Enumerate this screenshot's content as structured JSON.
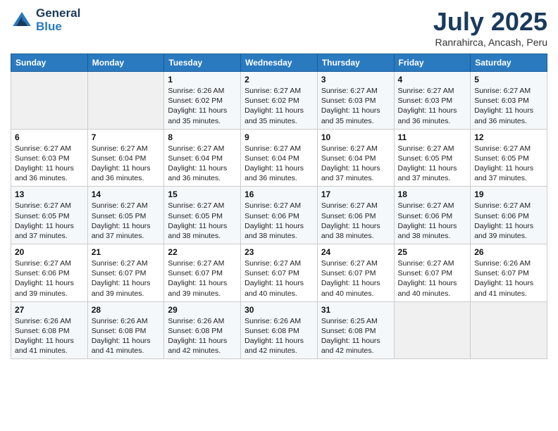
{
  "header": {
    "logo_general": "General",
    "logo_blue": "Blue",
    "title": "July 2025",
    "subtitle": "Ranrahirca, Ancash, Peru"
  },
  "weekdays": [
    "Sunday",
    "Monday",
    "Tuesday",
    "Wednesday",
    "Thursday",
    "Friday",
    "Saturday"
  ],
  "weeks": [
    [
      {
        "day": "",
        "info": ""
      },
      {
        "day": "",
        "info": ""
      },
      {
        "day": "1",
        "info": "Sunrise: 6:26 AM\nSunset: 6:02 PM\nDaylight: 11 hours and 35 minutes."
      },
      {
        "day": "2",
        "info": "Sunrise: 6:27 AM\nSunset: 6:02 PM\nDaylight: 11 hours and 35 minutes."
      },
      {
        "day": "3",
        "info": "Sunrise: 6:27 AM\nSunset: 6:03 PM\nDaylight: 11 hours and 35 minutes."
      },
      {
        "day": "4",
        "info": "Sunrise: 6:27 AM\nSunset: 6:03 PM\nDaylight: 11 hours and 36 minutes."
      },
      {
        "day": "5",
        "info": "Sunrise: 6:27 AM\nSunset: 6:03 PM\nDaylight: 11 hours and 36 minutes."
      }
    ],
    [
      {
        "day": "6",
        "info": "Sunrise: 6:27 AM\nSunset: 6:03 PM\nDaylight: 11 hours and 36 minutes."
      },
      {
        "day": "7",
        "info": "Sunrise: 6:27 AM\nSunset: 6:04 PM\nDaylight: 11 hours and 36 minutes."
      },
      {
        "day": "8",
        "info": "Sunrise: 6:27 AM\nSunset: 6:04 PM\nDaylight: 11 hours and 36 minutes."
      },
      {
        "day": "9",
        "info": "Sunrise: 6:27 AM\nSunset: 6:04 PM\nDaylight: 11 hours and 36 minutes."
      },
      {
        "day": "10",
        "info": "Sunrise: 6:27 AM\nSunset: 6:04 PM\nDaylight: 11 hours and 37 minutes."
      },
      {
        "day": "11",
        "info": "Sunrise: 6:27 AM\nSunset: 6:05 PM\nDaylight: 11 hours and 37 minutes."
      },
      {
        "day": "12",
        "info": "Sunrise: 6:27 AM\nSunset: 6:05 PM\nDaylight: 11 hours and 37 minutes."
      }
    ],
    [
      {
        "day": "13",
        "info": "Sunrise: 6:27 AM\nSunset: 6:05 PM\nDaylight: 11 hours and 37 minutes."
      },
      {
        "day": "14",
        "info": "Sunrise: 6:27 AM\nSunset: 6:05 PM\nDaylight: 11 hours and 37 minutes."
      },
      {
        "day": "15",
        "info": "Sunrise: 6:27 AM\nSunset: 6:05 PM\nDaylight: 11 hours and 38 minutes."
      },
      {
        "day": "16",
        "info": "Sunrise: 6:27 AM\nSunset: 6:06 PM\nDaylight: 11 hours and 38 minutes."
      },
      {
        "day": "17",
        "info": "Sunrise: 6:27 AM\nSunset: 6:06 PM\nDaylight: 11 hours and 38 minutes."
      },
      {
        "day": "18",
        "info": "Sunrise: 6:27 AM\nSunset: 6:06 PM\nDaylight: 11 hours and 38 minutes."
      },
      {
        "day": "19",
        "info": "Sunrise: 6:27 AM\nSunset: 6:06 PM\nDaylight: 11 hours and 39 minutes."
      }
    ],
    [
      {
        "day": "20",
        "info": "Sunrise: 6:27 AM\nSunset: 6:06 PM\nDaylight: 11 hours and 39 minutes."
      },
      {
        "day": "21",
        "info": "Sunrise: 6:27 AM\nSunset: 6:07 PM\nDaylight: 11 hours and 39 minutes."
      },
      {
        "day": "22",
        "info": "Sunrise: 6:27 AM\nSunset: 6:07 PM\nDaylight: 11 hours and 39 minutes."
      },
      {
        "day": "23",
        "info": "Sunrise: 6:27 AM\nSunset: 6:07 PM\nDaylight: 11 hours and 40 minutes."
      },
      {
        "day": "24",
        "info": "Sunrise: 6:27 AM\nSunset: 6:07 PM\nDaylight: 11 hours and 40 minutes."
      },
      {
        "day": "25",
        "info": "Sunrise: 6:27 AM\nSunset: 6:07 PM\nDaylight: 11 hours and 40 minutes."
      },
      {
        "day": "26",
        "info": "Sunrise: 6:26 AM\nSunset: 6:07 PM\nDaylight: 11 hours and 41 minutes."
      }
    ],
    [
      {
        "day": "27",
        "info": "Sunrise: 6:26 AM\nSunset: 6:08 PM\nDaylight: 11 hours and 41 minutes."
      },
      {
        "day": "28",
        "info": "Sunrise: 6:26 AM\nSunset: 6:08 PM\nDaylight: 11 hours and 41 minutes."
      },
      {
        "day": "29",
        "info": "Sunrise: 6:26 AM\nSunset: 6:08 PM\nDaylight: 11 hours and 42 minutes."
      },
      {
        "day": "30",
        "info": "Sunrise: 6:26 AM\nSunset: 6:08 PM\nDaylight: 11 hours and 42 minutes."
      },
      {
        "day": "31",
        "info": "Sunrise: 6:25 AM\nSunset: 6:08 PM\nDaylight: 11 hours and 42 minutes."
      },
      {
        "day": "",
        "info": ""
      },
      {
        "day": "",
        "info": ""
      }
    ]
  ]
}
